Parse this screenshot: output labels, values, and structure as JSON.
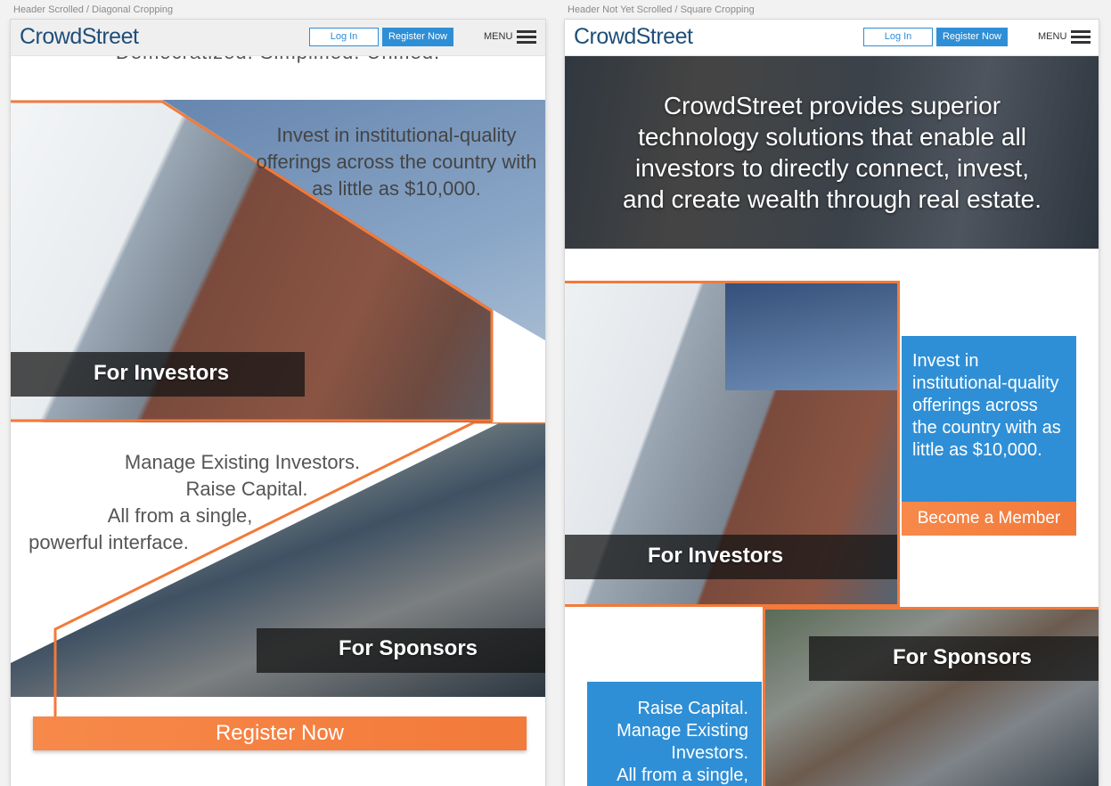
{
  "left_frame": {
    "caption": "Header Scrolled / Diagonal Cropping",
    "header": {
      "logo": "CrowdStreet",
      "login": "Log In",
      "register": "Register Now",
      "menu": "MENU"
    },
    "tagline_partial": "Democratized. Simplified. Unified.",
    "investors": {
      "text": "Invest in institutional-quality offerings across the country with as little as $10,000.",
      "label": "For Investors"
    },
    "sponsors": {
      "text_lines": [
        "Manage Existing Investors.",
        "Raise Capital.",
        "All from a single,",
        "powerful interface."
      ],
      "label": "For Sponsors"
    },
    "cta": "Register Now"
  },
  "right_frame": {
    "caption": "Header Not Yet Scrolled / Square Cropping",
    "header": {
      "logo": "CrowdStreet",
      "login": "Log In",
      "register": "Register Now",
      "menu": "MENU"
    },
    "hero_text": "CrowdStreet provides superior technology solutions that enable all investors to directly connect, invest, and create wealth through real estate.",
    "investors": {
      "label": "For Investors",
      "box_text": "Invest in institutional-quality offerings across the country with as little as $10,000.",
      "cta": "Become a Member"
    },
    "sponsors": {
      "label": "For Sponsors",
      "box_lines": [
        "Raise Capital.",
        "Manage Existing",
        "Investors.",
        "All from a single,"
      ]
    }
  },
  "colors": {
    "brand_blue": "#2f8fd6",
    "accent_orange": "#f27a3a",
    "logo_navy": "#1f4e79"
  }
}
